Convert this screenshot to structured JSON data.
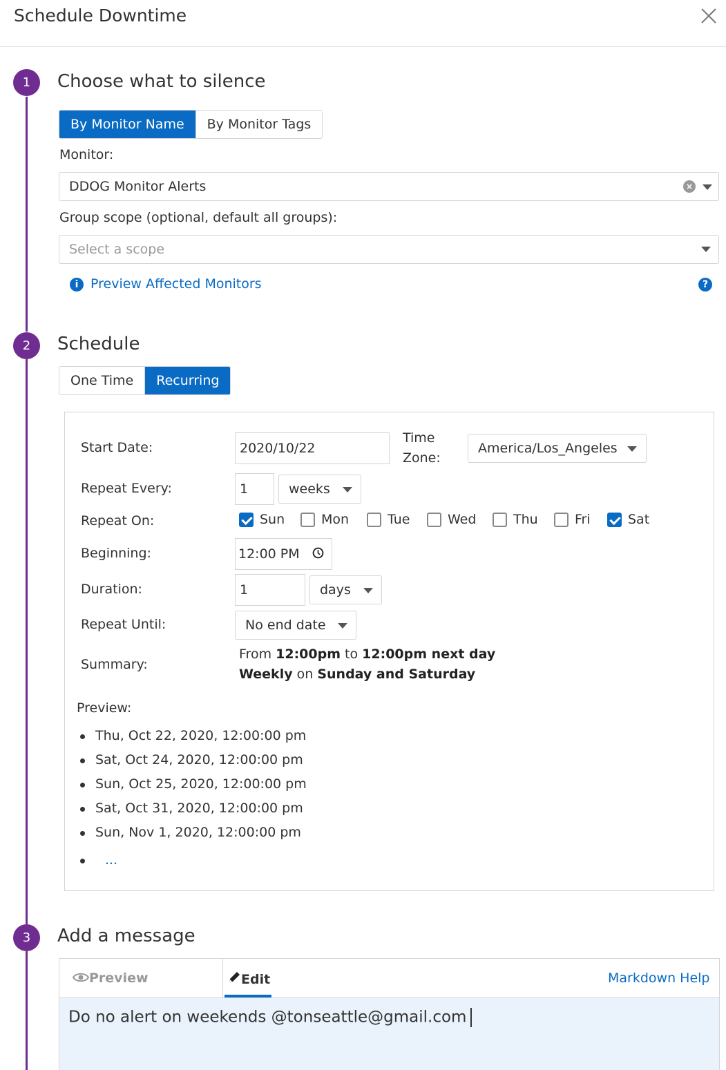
{
  "dialog": {
    "title": "Schedule Downtime"
  },
  "step1": {
    "number": "1",
    "title": "Choose what to silence",
    "tabs": [
      "By Monitor Name",
      "By Monitor Tags"
    ],
    "active_tab": "By Monitor Name",
    "monitor_label": "Monitor:",
    "monitor_value": "DDOG Monitor Alerts",
    "scope_label": "Group scope (optional, default all groups):",
    "scope_placeholder": "Select a scope",
    "preview_link": "Preview Affected Monitors",
    "info_icon": "i",
    "help_icon": "?"
  },
  "step2": {
    "number": "2",
    "title": "Schedule",
    "tabs": [
      "One Time",
      "Recurring"
    ],
    "active_tab": "Recurring",
    "start_date_label": "Start Date:",
    "start_date": "2020/10/22",
    "timezone_label_1": "Time",
    "timezone_label_2": "Zone:",
    "timezone": "America/Los_Angeles",
    "repeat_every_label": "Repeat Every:",
    "repeat_every_value": "1",
    "repeat_every_unit": "weeks",
    "repeat_on_label": "Repeat On:",
    "days": [
      {
        "label": "Sun",
        "checked": true
      },
      {
        "label": "Mon",
        "checked": false
      },
      {
        "label": "Tue",
        "checked": false
      },
      {
        "label": "Wed",
        "checked": false
      },
      {
        "label": "Thu",
        "checked": false
      },
      {
        "label": "Fri",
        "checked": false
      },
      {
        "label": "Sat",
        "checked": true
      }
    ],
    "beginning_label": "Beginning:",
    "beginning_value": "12:00 PM",
    "duration_label": "Duration:",
    "duration_value": "1",
    "duration_unit": "days",
    "repeat_until_label": "Repeat Until:",
    "repeat_until_value": "No end date",
    "summary_label": "Summary:",
    "summary": {
      "line1_from": "From ",
      "line1_start": "12:00pm",
      "line1_to": " to ",
      "line1_end": "12:00pm next day",
      "line2_freq": "Weekly",
      "line2_on": " on ",
      "line2_days": "Sunday and Saturday"
    },
    "preview_label": "Preview:",
    "preview_items": [
      "Thu, Oct 22, 2020, 12:00:00 pm",
      "Sat, Oct 24, 2020, 12:00:00 pm",
      "Sun, Oct 25, 2020, 12:00:00 pm",
      "Sat, Oct 31, 2020, 12:00:00 pm",
      "Sun, Nov 1, 2020, 12:00:00 pm"
    ],
    "preview_more": "..."
  },
  "step3": {
    "number": "3",
    "title": "Add a message",
    "tab_preview": "Preview",
    "tab_edit": "Edit",
    "markdown_help": "Markdown Help",
    "message": "Do no alert on weekends @tonseattle@gmail.com"
  },
  "colors": {
    "accent": "#0a6bc4",
    "timeline": "#6f2c91",
    "message_bg": "#eaf3fb"
  }
}
